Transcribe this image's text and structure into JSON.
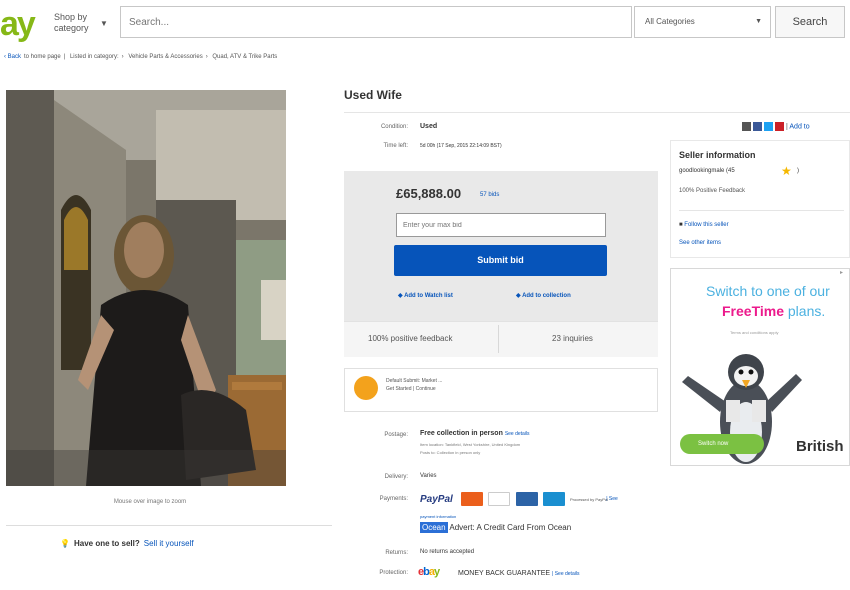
{
  "header": {
    "logo_text": "ay",
    "shop_by": "Shop by category",
    "search_placeholder": "Search...",
    "category_selected": "All Categories",
    "search_button": "Search"
  },
  "breadcrumb": [
    "to home page",
    "Listed in category:",
    "Vehicle Parts & Accessories",
    "Quad, ATV & Trike Parts"
  ],
  "photo": {
    "caption": "Mouse over image to zoom"
  },
  "sell": {
    "prompt": "Have one to sell?",
    "link": "Sell it yourself"
  },
  "item": {
    "title": "Used Wife",
    "condition_label": "Condition:",
    "condition_value": "Used",
    "time_left_label": "Time left:",
    "time_left_value": "5d 00h (17 Sep, 2015  22:14:09 BST)"
  },
  "share": {
    "add_label": "Add to"
  },
  "bid": {
    "price": "£65,888.00",
    "bids": "57 bids",
    "max_bid_placeholder": "Enter your max bid",
    "submit": "Submit bid",
    "watch": "Add to Watch list",
    "collection": "Add to collection"
  },
  "stats": {
    "feedback": "100% positive feedback",
    "inquiries": "23 inquiries"
  },
  "promo": {
    "line1": "Default Submit: Market ...",
    "line2": "Get Started | Continue"
  },
  "seller": {
    "title": "Seller information",
    "name": "goodlookingmale (45",
    "score": ")",
    "feedback": "100% Positive Feedback",
    "follow": "Follow this seller",
    "other_items": "See other items"
  },
  "ad": {
    "line1": "Switch to one of our",
    "line2_plain": "",
    "line2_brand": "FreeTime",
    "line2_suffix": " plans.",
    "fine": "Terms and conditions apply",
    "button": "Switch now",
    "brand": "British"
  },
  "details": {
    "postage_label": "Postage:",
    "postage_value": "Free collection in person",
    "postage_link": "See details",
    "postage_fine1": "Item location: Tankfield, West Yorkshire, United Kingdom",
    "postage_fine2": "Posts to: Collection in person only",
    "delivery_label": "Delivery:",
    "delivery_value": "Varies",
    "payments_label": "Payments:",
    "payments_paypal": "PayPal",
    "payments_processed": "Processed by PayPal",
    "payments_see": "| See",
    "payments_fine": "payment information",
    "ocean_highlight": "Ocean",
    "ocean_text": "Advert: A Credit Card From Ocean",
    "returns_label": "Returns:",
    "returns_value": "No returns accepted",
    "protection_label": "Protection:",
    "protection_value": "MONEY BACK GUARANTEE",
    "protection_link": "| See details"
  },
  "colors": {
    "ebay_blue": "#0654ba",
    "ad_blue": "#4bb1e0",
    "ad_pink": "#ec1a8c",
    "star": "#f5b800"
  }
}
